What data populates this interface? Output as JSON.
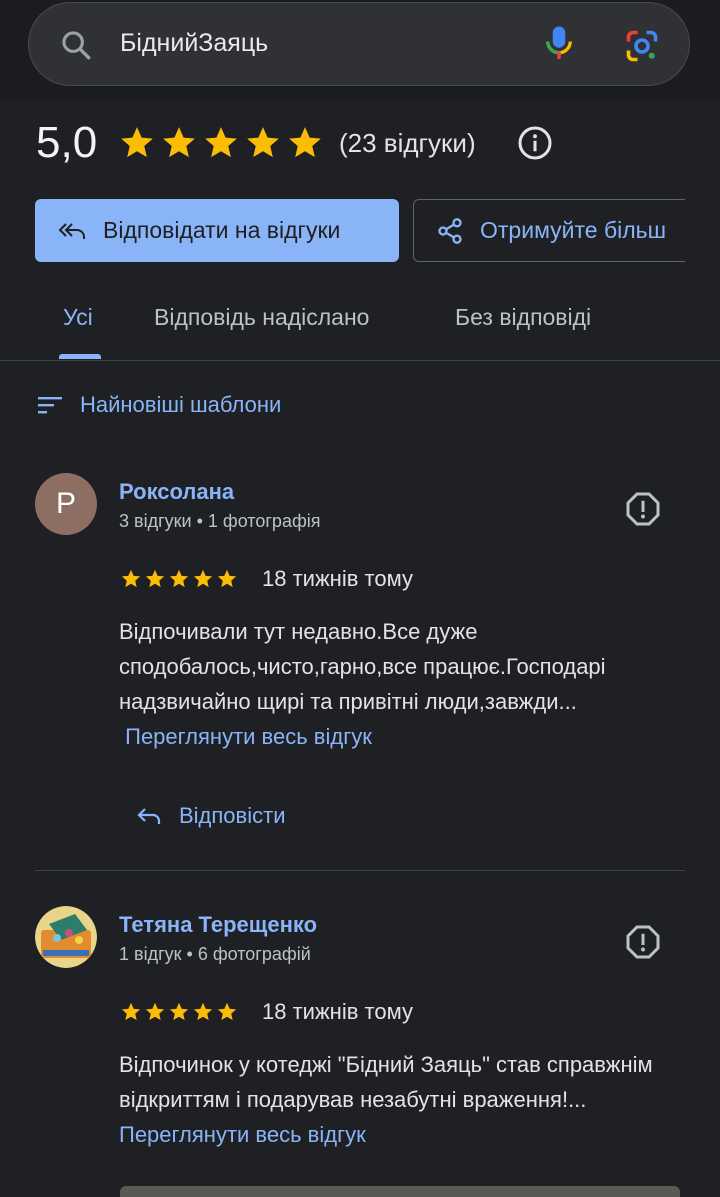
{
  "search": {
    "query": "БіднийЗаяць"
  },
  "summary": {
    "score": "5,0",
    "count": "(23 відгуки)",
    "star_color": "#fbbc04"
  },
  "actions": {
    "reply_all": "Відповідати на відгуки",
    "get_more": "Отримуйте більш"
  },
  "tabs": [
    {
      "label": "Усі",
      "active": true
    },
    {
      "label": "Відповідь надіслано"
    },
    {
      "label": "Без відповіді"
    }
  ],
  "sort": {
    "label": "Найновіші шаблони"
  },
  "reviews": [
    {
      "avatar_letter": "P",
      "name": "Роксолана",
      "meta": "3 відгуки • 1 фотографія",
      "rating": 5,
      "ago": "18 тижнів тому",
      "text": "Відпочивали тут недавно.Все дуже сподобалось,чисто,гарно,все працює.Господарі надзвичайно щирі та привітні люди,завжди...",
      "more": "Переглянути весь відгук",
      "reply": "Відповісти"
    },
    {
      "name": "Тетяна Терещенко",
      "meta": "1 відгук • 6 фотографій",
      "rating": 5,
      "ago": "18 тижнів тому",
      "text": "Відпочинок у котеджі \"Бідний Заяць\" став справжнім відкриттям і подарував незабутні враження!...",
      "more": "Переглянути весь відгук"
    }
  ],
  "colors": {
    "accent": "#8ab4f8",
    "background": "#1f2024"
  }
}
